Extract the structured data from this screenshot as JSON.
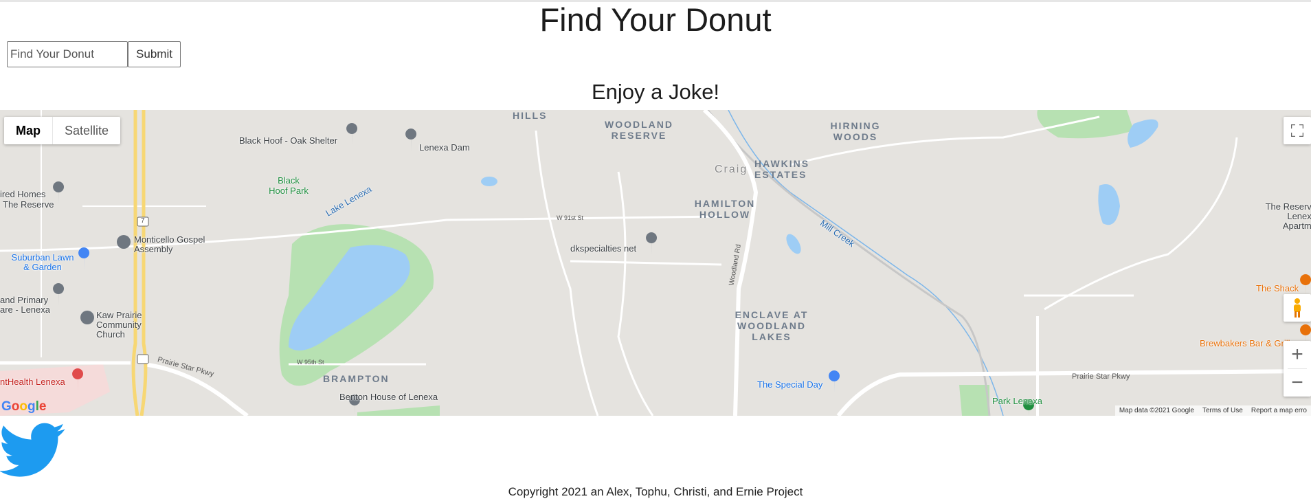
{
  "header": {
    "title": "Find Your Donut"
  },
  "search": {
    "placeholder": "Find Your Donut",
    "submit_label": "Submit"
  },
  "joke": {
    "heading": "Enjoy a Joke!"
  },
  "map": {
    "type_controls": {
      "map_label": "Map",
      "satellite_label": "Satellite",
      "selected": "Map"
    },
    "areas": {
      "hills": "HILLS",
      "woodland_reserve": "WOODLAND RESERVE",
      "hirning_woods": "HIRNING WOODS",
      "hawkins_estates": "HAWKINS ESTATES",
      "hamilton_hollow": "HAMILTON HOLLOW",
      "enclave": "ENCLAVE AT WOODLAND LAKES",
      "brampton": "BRAMPTON",
      "craig": "Craig"
    },
    "places": {
      "black_hoof_shelter": "Black Hoof - Oak Shelter",
      "lenexa_dam": "Lenexa Dam",
      "black_hoof_park": "Black Hoof Park",
      "lake_lenexa": "Lake Lenexa",
      "tired_homes": "ired Homes",
      "tired_homes_2": "The Reserve",
      "monticello_gospel": "Monticello Gospel Assembly",
      "suburban_lawn": "Suburban Lawn & Garden",
      "primary_care": "and Primary are - Lenexa",
      "kaw_prairie": "Kaw Prairie Community Church",
      "health_lenexa": "ntHealth Lenexa",
      "benton_house": "Benton House of Lenexa",
      "dkspecialties": "dkspecialties net",
      "special_day": "The Special Day",
      "park_lenexa": "Park Lenexa",
      "the_shack": "The Shack",
      "brewbakers": "Brewbakers Bar & Grill",
      "reserve_lenexa": "The Reserve Lenexa Apartme",
      "mill_creek": "Mill Creek",
      "prairie_star_pkwy": "Prairie Star Pkwy",
      "woodland_rd": "Woodland Rd",
      "w_91st": "W 91st St",
      "w_95th": "W 95th St",
      "route_7": "7"
    },
    "attribution": {
      "data": "Map data ©2021 Google",
      "terms": "Terms of Use",
      "report": "Report a map erro"
    },
    "google_logo": "Google",
    "zoom_in": "+",
    "zoom_out": "−"
  },
  "footer": {
    "copyright": "Copyright 2021 an Alex, Tophu, Christi, and Ernie Project"
  },
  "icons": {
    "twitter": "twitter-bird-icon",
    "fullscreen": "fullscreen-icon",
    "pegman": "pegman-icon"
  },
  "colors": {
    "map_bg": "#e5e3df",
    "park": "#b7e1b2",
    "water": "#9ecdf5",
    "highway": "#f7d774",
    "twitter": "#1d9bf0"
  }
}
